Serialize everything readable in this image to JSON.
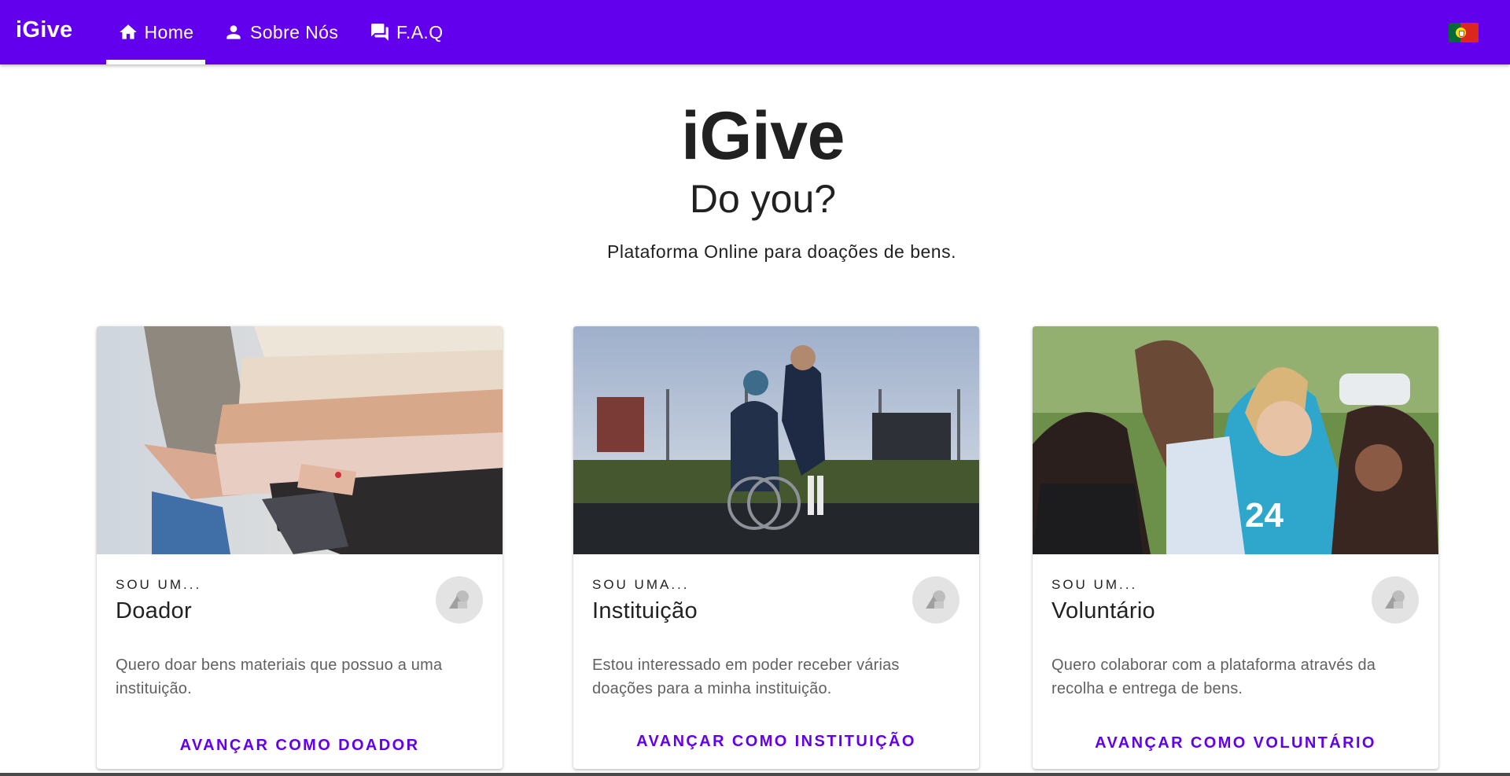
{
  "app": {
    "brand": "iGive"
  },
  "nav": {
    "tabs": [
      {
        "label": "Home",
        "icon": "home-icon",
        "active": true
      },
      {
        "label": "Sobre Nós",
        "icon": "person-icon",
        "active": false
      },
      {
        "label": "F.A.Q",
        "icon": "forum-icon",
        "active": false
      }
    ],
    "language_flag": "portugal-flag-icon"
  },
  "hero": {
    "title": "iGive",
    "subtitle": "Do you?",
    "description": "Plataforma Online para doações de bens."
  },
  "cards": [
    {
      "overline": "SOU UM...",
      "title": "Doador",
      "text": "Quero doar bens materiais que possuo a uma instituição.",
      "action": "AVANÇAR COMO DOADOR",
      "image": "folded-sweaters-photo"
    },
    {
      "overline": "SOU UMA...",
      "title": "Instituição",
      "text": "Estou interessado em poder receber várias doações para a minha instituição.",
      "action": "AVANÇAR COMO INSTITUIÇÃO",
      "image": "wheelchair-photo"
    },
    {
      "overline": "SOU UM...",
      "title": "Voluntário",
      "text": "Quero colaborar com a plataforma através da recolha e entrega de bens.",
      "action": "AVANÇAR COMO VOLUNTÁRIO",
      "image": "volunteer-children-photo"
    }
  ],
  "colors": {
    "primary": "#6200ee",
    "on_primary": "#ffffff",
    "text": "#212121",
    "muted_text": "#616161"
  }
}
